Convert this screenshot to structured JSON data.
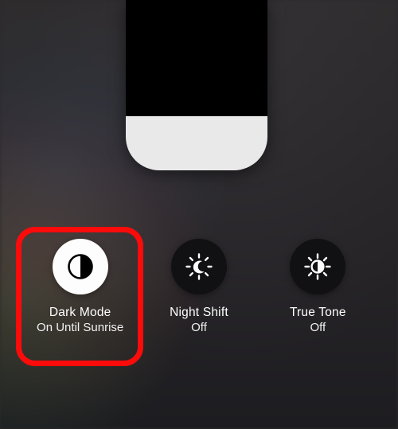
{
  "brightness": {
    "level_percent": 32
  },
  "toggles": {
    "dark_mode": {
      "label": "Dark Mode",
      "status": "On Until Sunrise",
      "on": true
    },
    "night_shift": {
      "label": "Night Shift",
      "status": "Off",
      "on": false
    },
    "true_tone": {
      "label": "True Tone",
      "status": "Off",
      "on": false
    }
  },
  "annotation": {
    "highlight_target": "dark-mode-toggle",
    "color": "#fc0b0b"
  }
}
